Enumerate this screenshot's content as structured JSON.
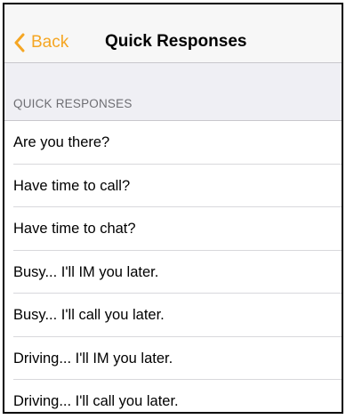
{
  "navbar": {
    "back_label": "Back",
    "title": "Quick Responses",
    "back_icon": "chevron-left-icon",
    "accent_color": "#f5a623"
  },
  "section": {
    "header": "QUICK RESPONSES"
  },
  "list": {
    "items": [
      {
        "label": "Are you there?"
      },
      {
        "label": "Have time to call?"
      },
      {
        "label": "Have time to chat?"
      },
      {
        "label": "Busy... I'll IM you later."
      },
      {
        "label": "Busy... I'll call you later."
      },
      {
        "label": "Driving... I'll IM you later."
      },
      {
        "label": "Driving... I'll call you later."
      }
    ]
  }
}
